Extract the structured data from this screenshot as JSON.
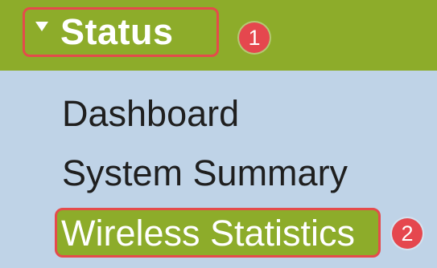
{
  "header": {
    "title": "Status",
    "expand_icon": "triangle-down-icon",
    "step": "1"
  },
  "menu": {
    "items": [
      {
        "label": "Dashboard",
        "active": false
      },
      {
        "label": "System Summary",
        "active": false
      },
      {
        "label": "Wireless Statistics",
        "active": true,
        "step": "2"
      }
    ]
  },
  "colors": {
    "header_bg": "#8dac2a",
    "menu_bg": "#bfd3e7",
    "highlight_border": "#e54b4b",
    "badge_bg": "#e5474e",
    "text_dark": "#1f1f1f",
    "text_light": "#ffffff"
  }
}
